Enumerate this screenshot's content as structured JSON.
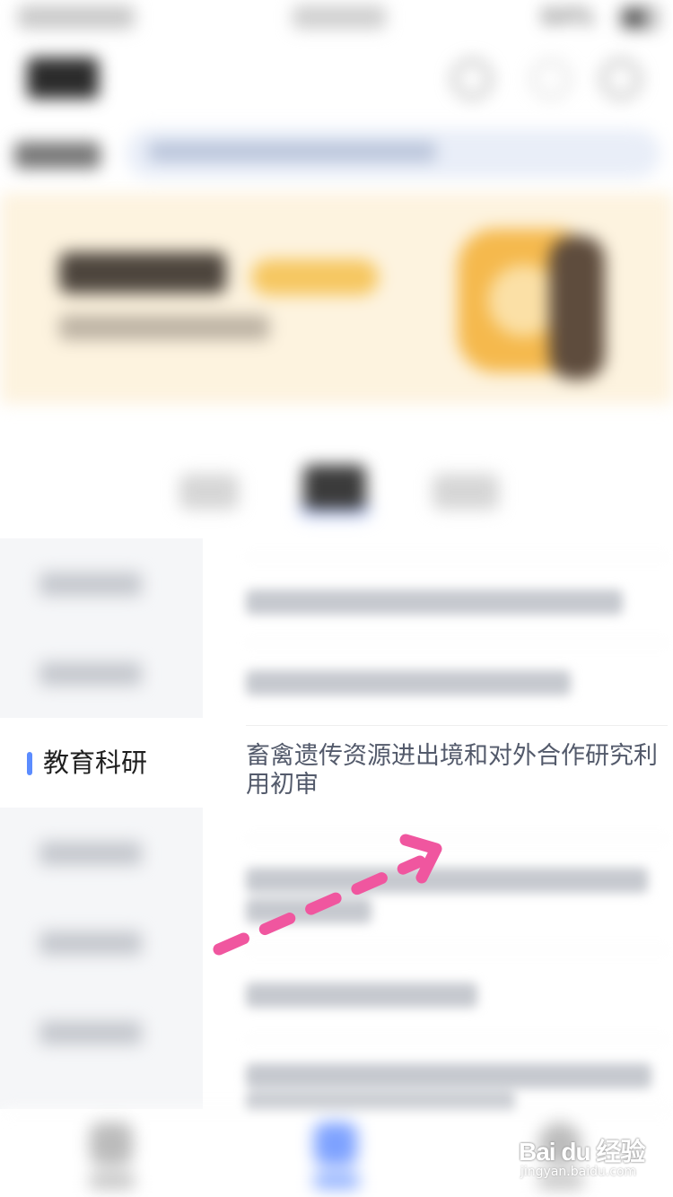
{
  "status_bar": {
    "battery_percent": "64%"
  },
  "sidebar": {
    "active_item": {
      "label": "教育科研"
    }
  },
  "list": {
    "active_item": {
      "title": "畜禽遗传资源进出境和对外合作研究利用初审"
    }
  },
  "watermark": {
    "brand": "Bai du 经验",
    "url": "jingyan.baidu.com"
  },
  "colors": {
    "accent": "#5b8cff",
    "annotation_arrow": "#f0569f",
    "banner_bg": "#fdf3df",
    "sidebar_bg": "#f5f6f8"
  }
}
